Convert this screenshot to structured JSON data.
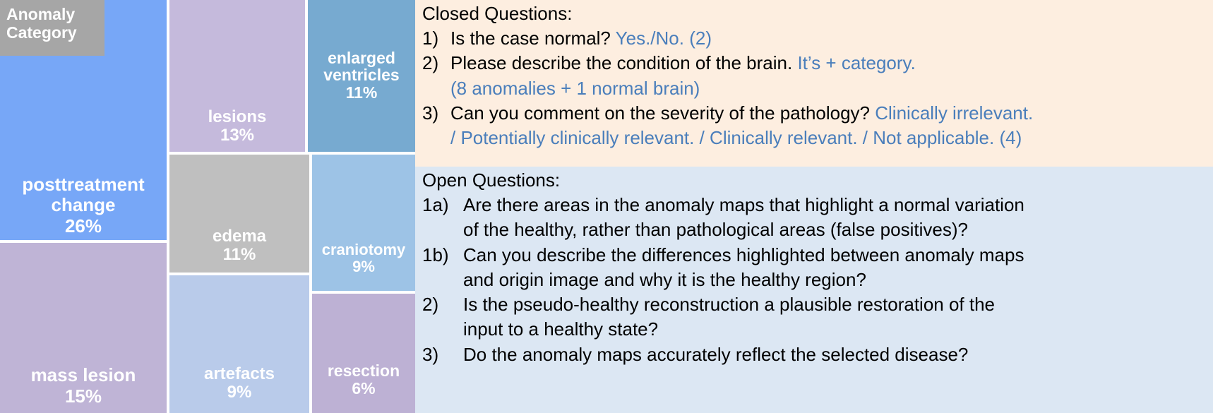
{
  "treemap": {
    "legend_badge": {
      "line1": "Anomaly",
      "line2": "Category"
    },
    "colors": {
      "posttreatment_change": "#77a7f7",
      "mass_lesion": "#bfb4d6",
      "lesions": "#c5badc",
      "edema": "#bfbfbf",
      "artefacts": "#b9cbea",
      "enlarged_ventricles": "#77aad0",
      "craniotomy": "#9dc3e6",
      "resection": "#bdb1d4",
      "gap": "#ffffff",
      "badge": "#a6a6a6"
    },
    "tiles": [
      {
        "label": "posttreatment\nchange",
        "label_line1": "posttreatment",
        "label_line2": "change",
        "percent": "26%",
        "value": 26
      },
      {
        "label": "mass lesion",
        "percent": "15%",
        "value": 15
      },
      {
        "label": "lesions",
        "percent": "13%",
        "value": 13
      },
      {
        "label": "edema",
        "percent": "11%",
        "value": 11
      },
      {
        "label": "enlarged\nventricles",
        "label_line1": "enlarged",
        "label_line2": "ventricles",
        "percent": "11%",
        "value": 11
      },
      {
        "label": "craniotomy",
        "percent": "9%",
        "value": 9
      },
      {
        "label": "artefacts",
        "percent": "9%",
        "value": 9
      },
      {
        "label": "resection",
        "percent": "6%",
        "value": 6
      }
    ]
  },
  "chart_data": {
    "type": "treemap",
    "title": "Anomaly Category",
    "categories": [
      "posttreatment change",
      "mass lesion",
      "lesions",
      "edema",
      "enlarged ventricles",
      "craniotomy",
      "artefacts",
      "resection"
    ],
    "values": [
      26,
      15,
      13,
      11,
      11,
      9,
      9,
      6
    ],
    "value_labels": [
      "26%",
      "15%",
      "13%",
      "11%",
      "11%",
      "9%",
      "9%",
      "6%"
    ],
    "unit": "percent",
    "xlabel": "",
    "ylabel": "",
    "legend": "Anomaly Category"
  },
  "closed_panel": {
    "background": "#fdeee0",
    "title": "Closed Questions:",
    "questions": [
      {
        "num": "1)",
        "text": "Is the case normal? ",
        "answer": "Yes./No. (2)"
      },
      {
        "num": "2)",
        "text": "Please describe the condition of the brain. ",
        "answer": "It’s + category.",
        "cont_answer": "(8 anomalies + 1 normal brain)"
      },
      {
        "num": "3)",
        "text": "Can you comment on the severity of the pathology? ",
        "answer": "Clinically irrelevant.",
        "cont_answer": "/ Potentially clinically relevant. / Clinically relevant. / Not applicable. (4)"
      }
    ]
  },
  "open_panel": {
    "background": "#dce7f3",
    "title": "Open Questions:",
    "questions": [
      {
        "num": "1a)",
        "text": "Are there areas in the anomaly maps that highlight a normal variation",
        "cont": "of the healthy, rather than pathological areas (false positives)?"
      },
      {
        "num": "1b)",
        "text": "Can you describe the differences highlighted between anomaly maps",
        "cont": "and origin image and why it is the healthy region?"
      },
      {
        "num": "2)",
        "text": "Is the pseudo-healthy reconstruction a plausible restoration of the",
        "cont": "input to a healthy state?"
      },
      {
        "num": "3)",
        "text": "Do the anomaly maps accurately reflect the selected disease?"
      }
    ]
  }
}
